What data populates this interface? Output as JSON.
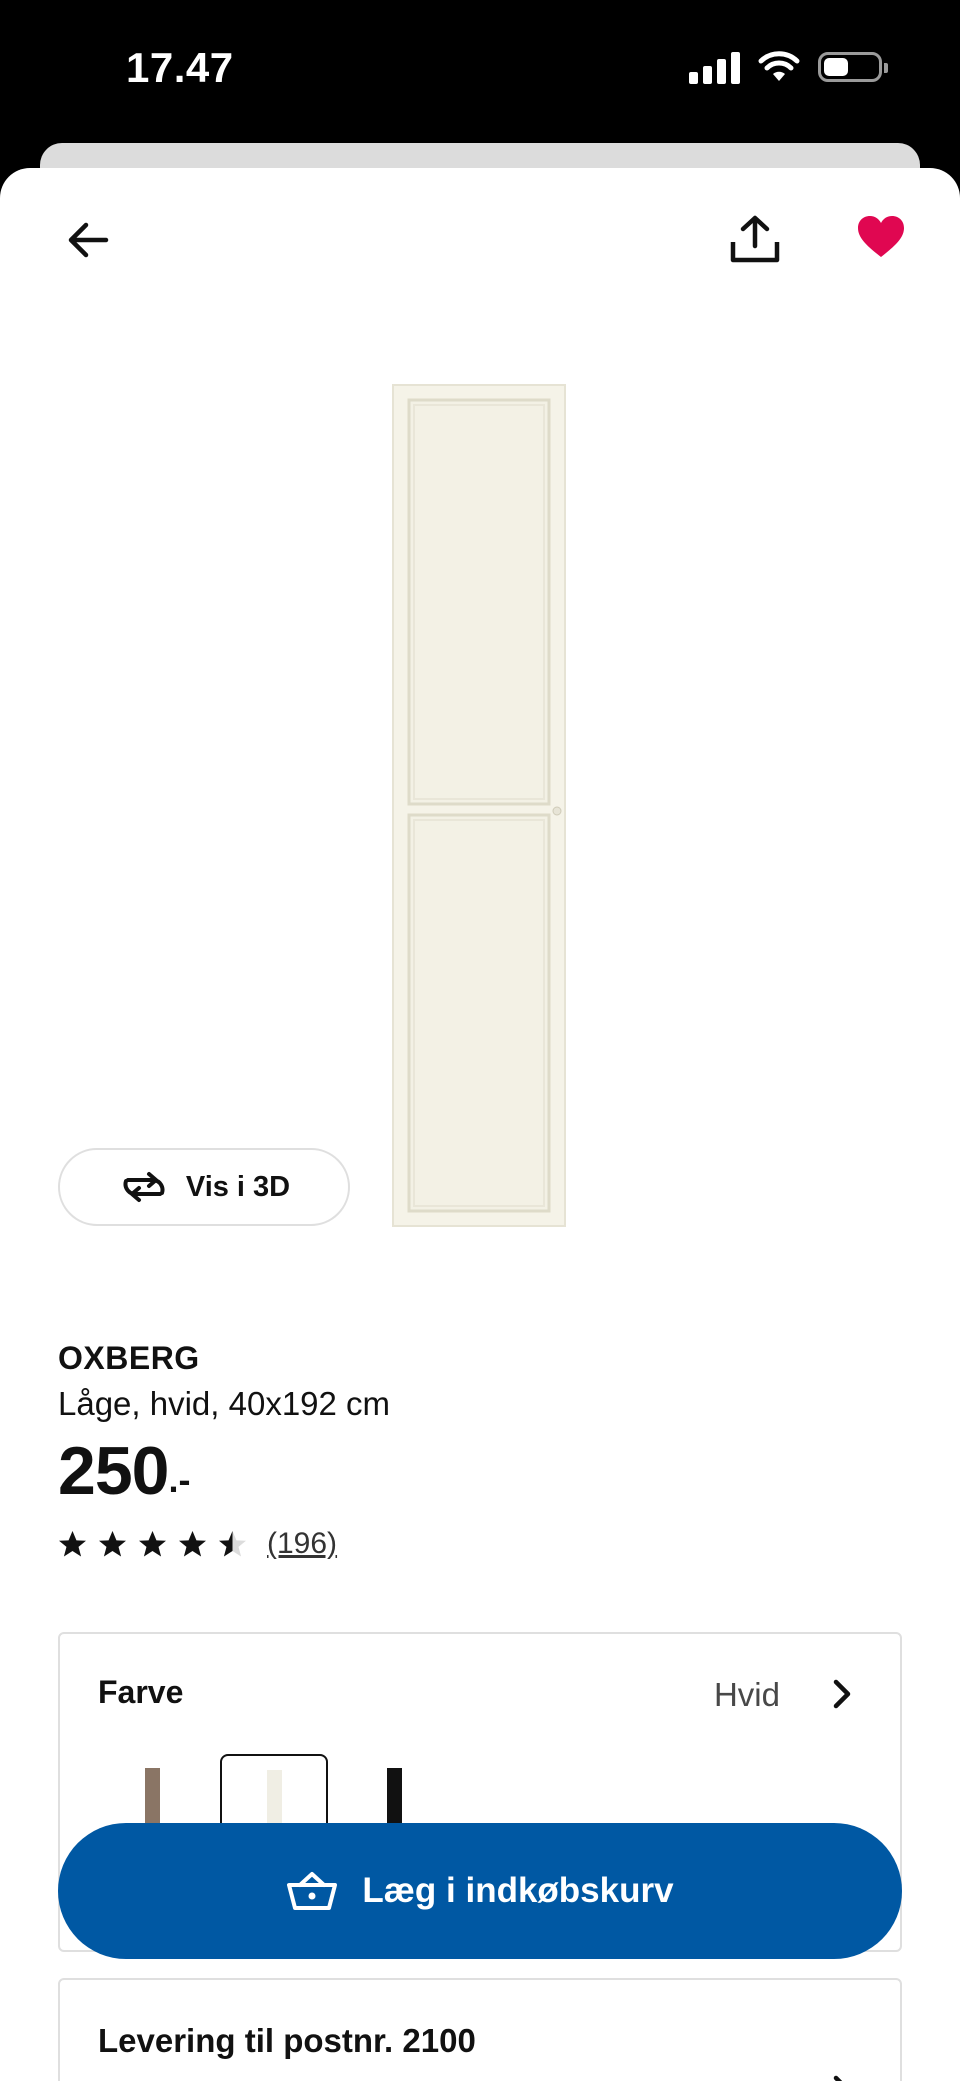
{
  "status_bar": {
    "time": "17.47"
  },
  "product": {
    "name": "OXBERG",
    "description": "Låge, hvid, 40x192 cm",
    "price": "250",
    "price_suffix": ".-",
    "rating": 4.5,
    "review_count": "(196)"
  },
  "view_3d_label": "Vis i 3D",
  "color_section": {
    "title": "Farve",
    "selected": "Hvid",
    "swatches": [
      {
        "name": "brown",
        "color": "#8a7565"
      },
      {
        "name": "white",
        "color": "#f0eee4"
      },
      {
        "name": "black",
        "color": "#111111"
      }
    ]
  },
  "add_to_cart_label": "Læg i indkøbskurv",
  "delivery": {
    "title": "Levering til postnr. 2100"
  },
  "colors": {
    "brand_blue": "#0058a3",
    "heart_red": "#e00751"
  }
}
